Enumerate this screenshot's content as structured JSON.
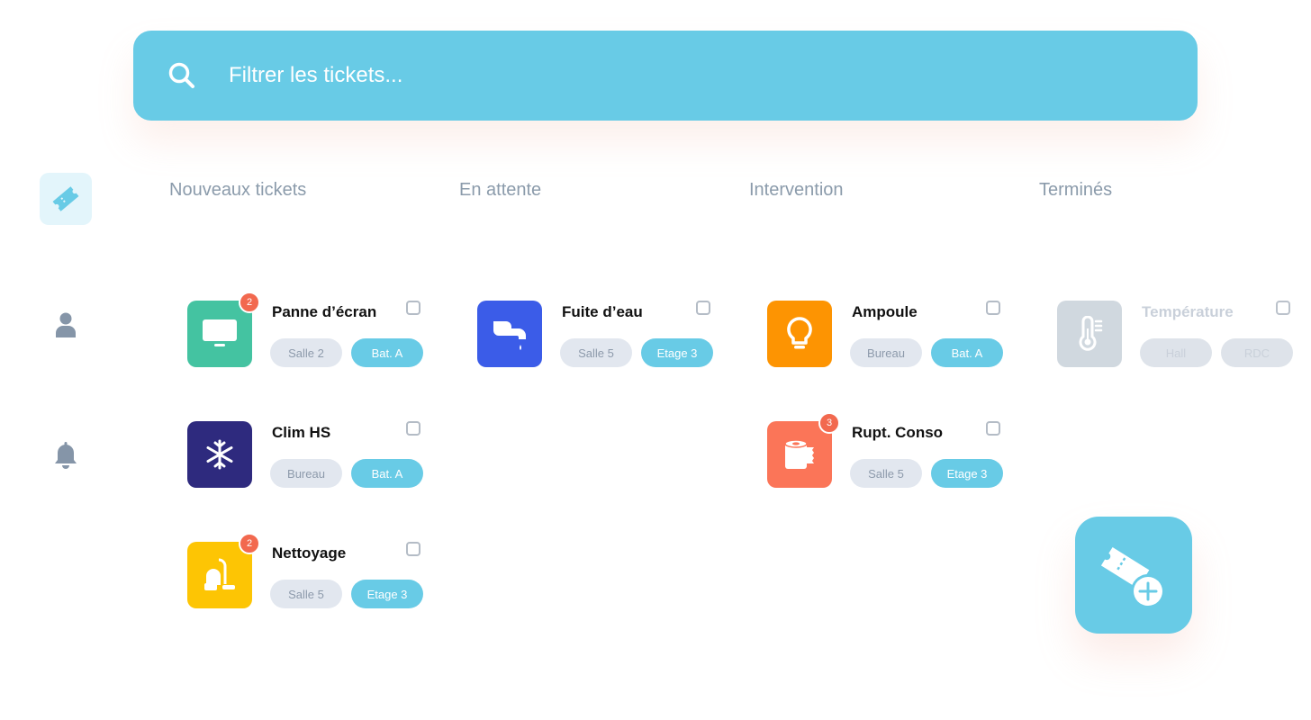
{
  "search": {
    "placeholder": "Filtrer les tickets..."
  },
  "sidebar": {
    "items": [
      {
        "icon": "ticket-icon",
        "active": true
      },
      {
        "icon": "user-icon",
        "active": false
      },
      {
        "icon": "bell-icon",
        "active": false
      }
    ]
  },
  "columns": [
    {
      "title": "Nouveaux tickets"
    },
    {
      "title": "En attente"
    },
    {
      "title": "Intervention"
    },
    {
      "title": "Terminés"
    }
  ],
  "tickets": {
    "panne": {
      "title": "Panne d’écran",
      "badge": "2",
      "loc": "Salle 2",
      "bld": "Bat. A",
      "color": "#44c3a1",
      "icon": "monitor-icon"
    },
    "clim": {
      "title": "Clim HS",
      "loc": "Bureau",
      "bld": "Bat. A",
      "color": "#2e2a7e",
      "icon": "snowflake-icon"
    },
    "nettoyage": {
      "title": "Nettoyage",
      "badge": "2",
      "loc": "Salle 5",
      "bld": "Etage 3",
      "color": "#fdc504",
      "icon": "vacuum-icon"
    },
    "fuite": {
      "title": "Fuite d’eau",
      "loc": "Salle 5",
      "bld": "Etage 3",
      "color": "#3b5ce8",
      "icon": "faucet-icon"
    },
    "ampoule": {
      "title": "Ampoule",
      "loc": "Bureau",
      "bld": "Bat. A",
      "color": "#fd9402",
      "icon": "lightbulb-icon"
    },
    "rupt": {
      "title": "Rupt. Conso",
      "badge": "3",
      "loc": "Salle 5",
      "bld": "Etage 3",
      "color": "#fb7558",
      "icon": "paper-roll-icon"
    },
    "temp": {
      "title": "Température",
      "loc": "Hall",
      "bld": "RDC",
      "color": "#ccd4dc",
      "icon": "thermometer-icon"
    }
  },
  "fab": {
    "icon": "add-ticket-icon"
  },
  "colors": {
    "accent": "#68cbe6",
    "badge": "#f2694f",
    "tag_loc": "#e2e7ef",
    "header_text": "#8b9bab"
  }
}
